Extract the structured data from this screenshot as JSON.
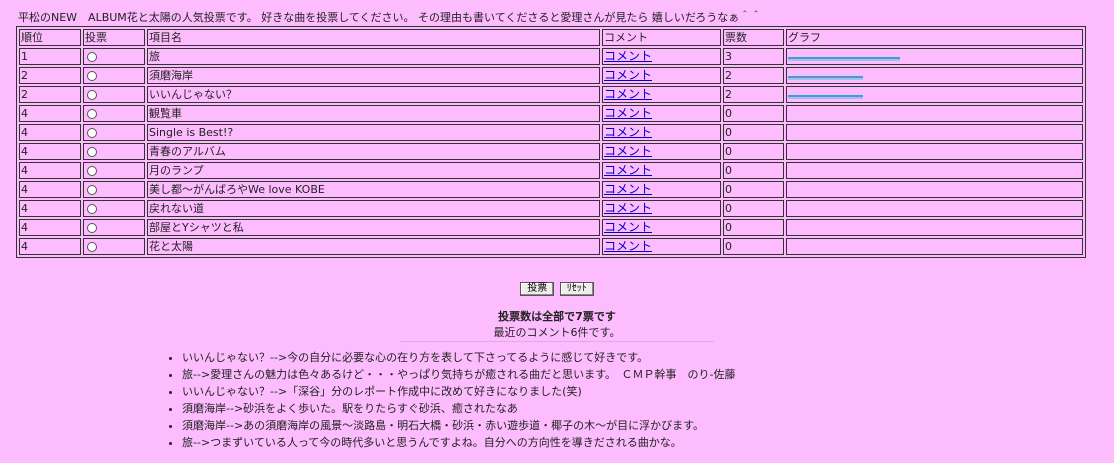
{
  "intro": "平松のNEW　ALBUM花と太陽の人気投票です。 好きな曲を投票してください。 その理由も書いてくださると愛理さんが見たら 嬉しいだろうなぁ＾＾",
  "headers": {
    "rank": "順位",
    "vote": "投票",
    "item": "項目名",
    "comment": "コメント",
    "count": "票数",
    "graph": "グラフ"
  },
  "rows": [
    {
      "rank": "1",
      "item": "旅",
      "comment": "コメント",
      "count": "3",
      "bar": 1.0
    },
    {
      "rank": "2",
      "item": "須磨海岸",
      "comment": "コメント",
      "count": "2",
      "bar": 0.667
    },
    {
      "rank": "2",
      "item": "いいんじゃない？",
      "comment": "コメント",
      "count": "2",
      "bar": 0.667
    },
    {
      "rank": "4",
      "item": "観覧車",
      "comment": "コメント",
      "count": "0",
      "bar": 0
    },
    {
      "rank": "4",
      "item": "Single is Best!?",
      "comment": "コメント",
      "count": "0",
      "bar": 0
    },
    {
      "rank": "4",
      "item": "青春のアルバム",
      "comment": "コメント",
      "count": "0",
      "bar": 0
    },
    {
      "rank": "4",
      "item": "月のランプ",
      "comment": "コメント",
      "count": "0",
      "bar": 0
    },
    {
      "rank": "4",
      "item": "美し都～がんばろやWe love KOBE",
      "comment": "コメント",
      "count": "0",
      "bar": 0
    },
    {
      "rank": "4",
      "item": "戻れない道",
      "comment": "コメント",
      "count": "0",
      "bar": 0
    },
    {
      "rank": "4",
      "item": "部屋とYシャツと私",
      "comment": "コメント",
      "count": "0",
      "bar": 0
    },
    {
      "rank": "4",
      "item": "花と太陽",
      "comment": "コメント",
      "count": "0",
      "bar": 0
    }
  ],
  "buttons": {
    "vote": "投票",
    "reset": "ﾘｾｯﾄ"
  },
  "total": "投票数は全部で7票です",
  "recent": "最近のコメント6件です。",
  "comments": [
    "いいんじゃない？-->今の自分に必要な心の在り方を表して下さってるように感じて好きです。",
    "旅-->愛理さんの魅力は色々あるけど・・・やっぱり気持ちが癒される曲だと思います。　ＣＭＰ幹事　のり-佐藤",
    "いいんじゃない？-->「深谷」分のレポート作成中に改めて好きになりました(笑)",
    "須磨海岸-->砂浜をよく歩いた。駅をりたらすぐ砂浜、癒されたなあ",
    "須磨海岸-->あの須磨海岸の風景～淡路島・明石大橋・砂浜・赤い遊歩道・椰子の木～が目に浮かびます。",
    "旅-->つまずいている人って今の時代多いと思うんですよね。自分への方向性を導きだされる曲かな。"
  ]
}
